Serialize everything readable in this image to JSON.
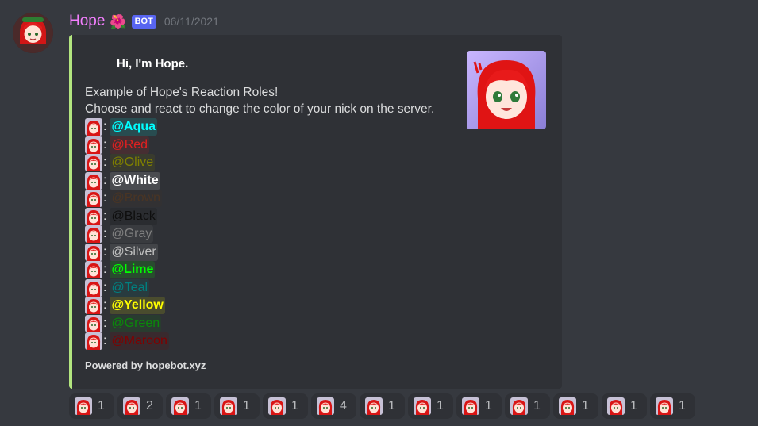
{
  "message": {
    "username": "Hope",
    "username_emoji": "🌺",
    "bot_tag": "BOT",
    "timestamp": "06/11/2021"
  },
  "embed": {
    "accent_color": "#b3e57f",
    "title": "Hi, I'm Hope.",
    "description_lines": [
      "Example of Hope's Reaction Roles!",
      "Choose and react to change the color of your nick on the server."
    ],
    "roles": [
      {
        "name": "@Aqua",
        "color": "#00ffff",
        "bold": true
      },
      {
        "name": "@Red",
        "color": "#e02020",
        "bold": false
      },
      {
        "name": "@Olive",
        "color": "#808000",
        "bold": false
      },
      {
        "name": "@White",
        "color": "#ffffff",
        "bold": true
      },
      {
        "name": "@Brown",
        "color": "#4a3524",
        "bold": false
      },
      {
        "name": "@Black",
        "color": "#0e0e0e",
        "bold": false
      },
      {
        "name": "@Gray",
        "color": "#808080",
        "bold": false
      },
      {
        "name": "@Silver",
        "color": "#c0c0c0",
        "bold": false
      },
      {
        "name": "@Lime",
        "color": "#00ff00",
        "bold": true
      },
      {
        "name": "@Teal",
        "color": "#008080",
        "bold": false
      },
      {
        "name": "@Yellow",
        "color": "#ffff00",
        "bold": true
      },
      {
        "name": "@Green",
        "color": "#0a8a0a",
        "bold": false
      },
      {
        "name": "@Maroon",
        "color": "#800000",
        "bold": false
      }
    ],
    "footer": "Powered by hopebot.xyz"
  },
  "reactions": [
    {
      "count": "1"
    },
    {
      "count": "2"
    },
    {
      "count": "1"
    },
    {
      "count": "1"
    },
    {
      "count": "1"
    },
    {
      "count": "4"
    },
    {
      "count": "1"
    },
    {
      "count": "1"
    },
    {
      "count": "1"
    },
    {
      "count": "1"
    },
    {
      "count": "1"
    },
    {
      "count": "1"
    },
    {
      "count": "1"
    }
  ],
  "icons": {
    "avatar": "avatar-icon",
    "thumbnail": "thumbnail-anime-girl-icon",
    "emoji": "red-hair-girl-emoji-icon"
  }
}
